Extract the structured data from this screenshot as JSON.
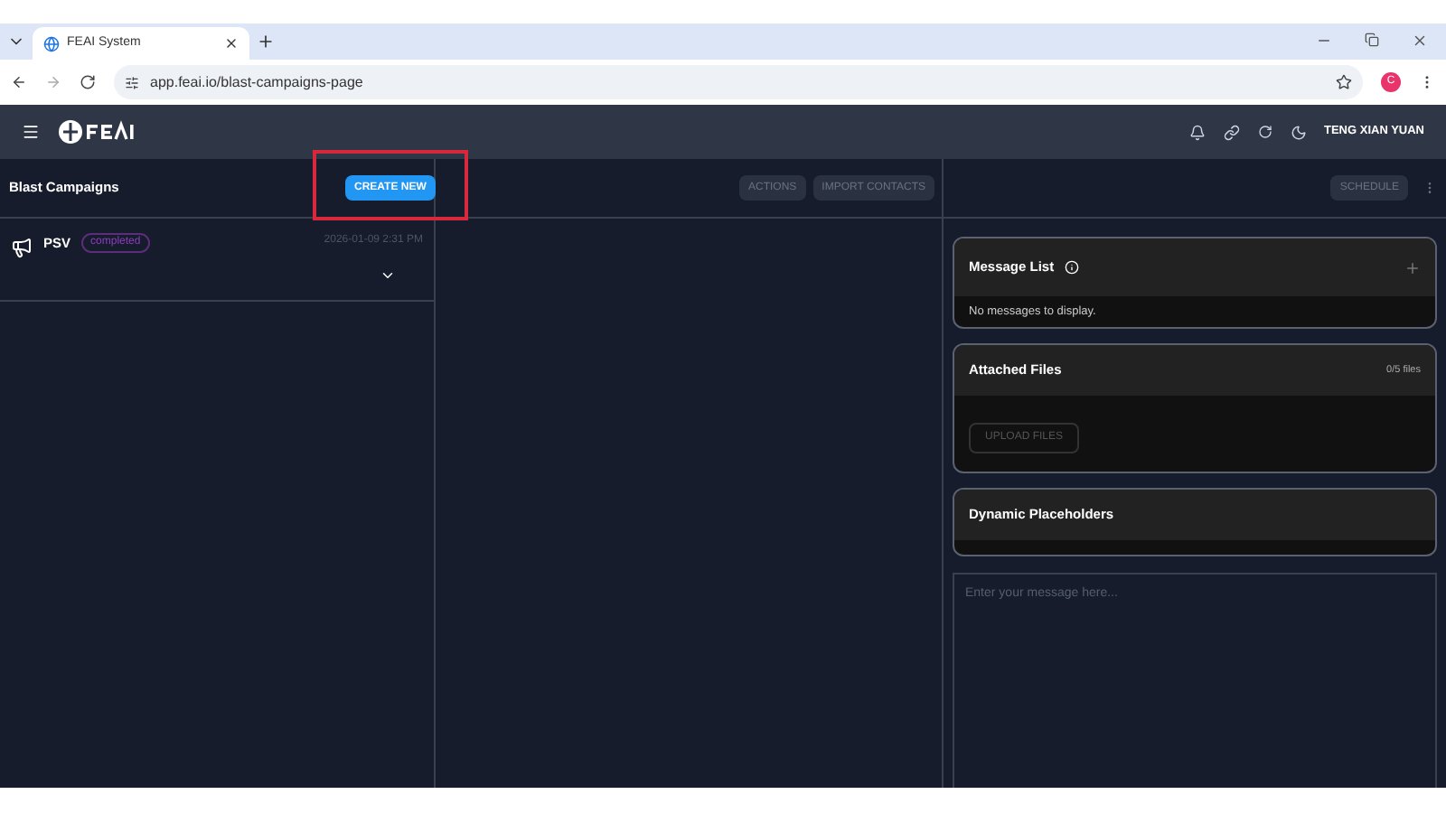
{
  "browser": {
    "tab_title": "FEAI System",
    "url": "app.feai.io/blast-campaigns-page",
    "profile_initial": "C"
  },
  "header": {
    "user": "TENG XIAN YUAN"
  },
  "campaigns_panel": {
    "title": "Blast Campaigns",
    "create_button": "CREATE NEW",
    "highlighted": true,
    "items": [
      {
        "name": "PSV",
        "status": "completed",
        "date": "2026-01-09 2:31 PM"
      }
    ]
  },
  "toolbar": {
    "buttons": [
      {
        "label": "ACTIONS",
        "disabled": true
      },
      {
        "label": "IMPORT CONTACTS",
        "disabled": true
      }
    ]
  },
  "right_panel": {
    "schedule_button": {
      "label": "SCHEDULE",
      "disabled": true
    },
    "message_list": {
      "title": "Message List",
      "empty": "No messages to display."
    },
    "attached_files": {
      "title": "Attached Files",
      "count": "0/5 files",
      "upload_button": "UPLOAD FILES"
    },
    "placeholders": {
      "title": "Dynamic Placeholders"
    },
    "message": {
      "placeholder": "Enter your message here..."
    }
  }
}
